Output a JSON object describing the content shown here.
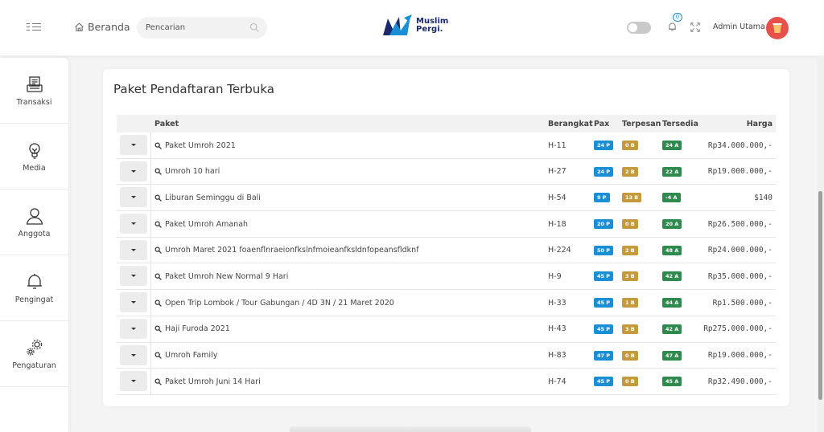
{
  "header": {
    "home_label": "Beranda",
    "search_placeholder": "Pencarian",
    "logo_line1": "Muslim",
    "logo_line2": "Pergi.",
    "notification_count": "0",
    "user_name": "Admin Utama",
    "colors": {
      "accent": "#1b8fd6",
      "avatar_bg": "#e8504b"
    }
  },
  "sidebar": {
    "items": [
      {
        "label": "Transaksi",
        "icon": "receipt-icon"
      },
      {
        "label": "Media",
        "icon": "lightbulb-icon"
      },
      {
        "label": "Anggota",
        "icon": "user-icon"
      },
      {
        "label": "Pengingat",
        "icon": "bell-icon"
      },
      {
        "label": "Pengaturan",
        "icon": "gears-icon"
      }
    ]
  },
  "main": {
    "title": "Paket Pendaftaran Terbuka",
    "columns": {
      "package": "Paket",
      "departure": "Berangkat",
      "pax": "Pax",
      "booked": "Terpesan",
      "available": "Tersedia",
      "price": "Harga"
    },
    "rows": [
      {
        "name": "Paket Umroh 2021",
        "departure": "H-11",
        "pax": "24 P",
        "booked": "0 B",
        "available": "24 A",
        "price": "Rp34.000.000,-"
      },
      {
        "name": "Umroh 10 hari",
        "departure": "H-27",
        "pax": "24 P",
        "booked": "2 B",
        "available": "22 A",
        "price": "Rp19.000.000,-"
      },
      {
        "name": "Liburan Seminggu di Bali",
        "departure": "H-54",
        "pax": "9 P",
        "booked": "13 B",
        "available": "-4 A",
        "price": "$140"
      },
      {
        "name": "Paket Umroh Amanah",
        "departure": "H-18",
        "pax": "20 P",
        "booked": "0 B",
        "available": "20 A",
        "price": "Rp26.500.000,-"
      },
      {
        "name": "Umroh Maret 2021 foaenflnraeionfkslnfmoieanfksldnfopeansfldknf",
        "departure": "H-224",
        "pax": "50 P",
        "booked": "2 B",
        "available": "48 A",
        "price": "Rp24.000.000,-"
      },
      {
        "name": "Paket Umroh New Normal 9 Hari",
        "departure": "H-9",
        "pax": "45 P",
        "booked": "3 B",
        "available": "42 A",
        "price": "Rp35.000.000,-"
      },
      {
        "name": "Open Trip Lombok / Tour Gabungan / 4D 3N / 21 Maret 2020",
        "departure": "H-33",
        "pax": "45 P",
        "booked": "1 B",
        "available": "44 A",
        "price": "Rp1.500.000,-"
      },
      {
        "name": "Haji Furoda 2021",
        "departure": "H-43",
        "pax": "45 P",
        "booked": "3 B",
        "available": "42 A",
        "price": "Rp275.000.000,-"
      },
      {
        "name": "Umroh Family",
        "departure": "H-83",
        "pax": "47 P",
        "booked": "0 B",
        "available": "47 A",
        "price": "Rp19.000.000,-"
      },
      {
        "name": "Paket Umroh Juni 14 Hari",
        "departure": "H-74",
        "pax": "45 P",
        "booked": "0 B",
        "available": "45 A",
        "price": "Rp32.490.000,-"
      }
    ]
  }
}
